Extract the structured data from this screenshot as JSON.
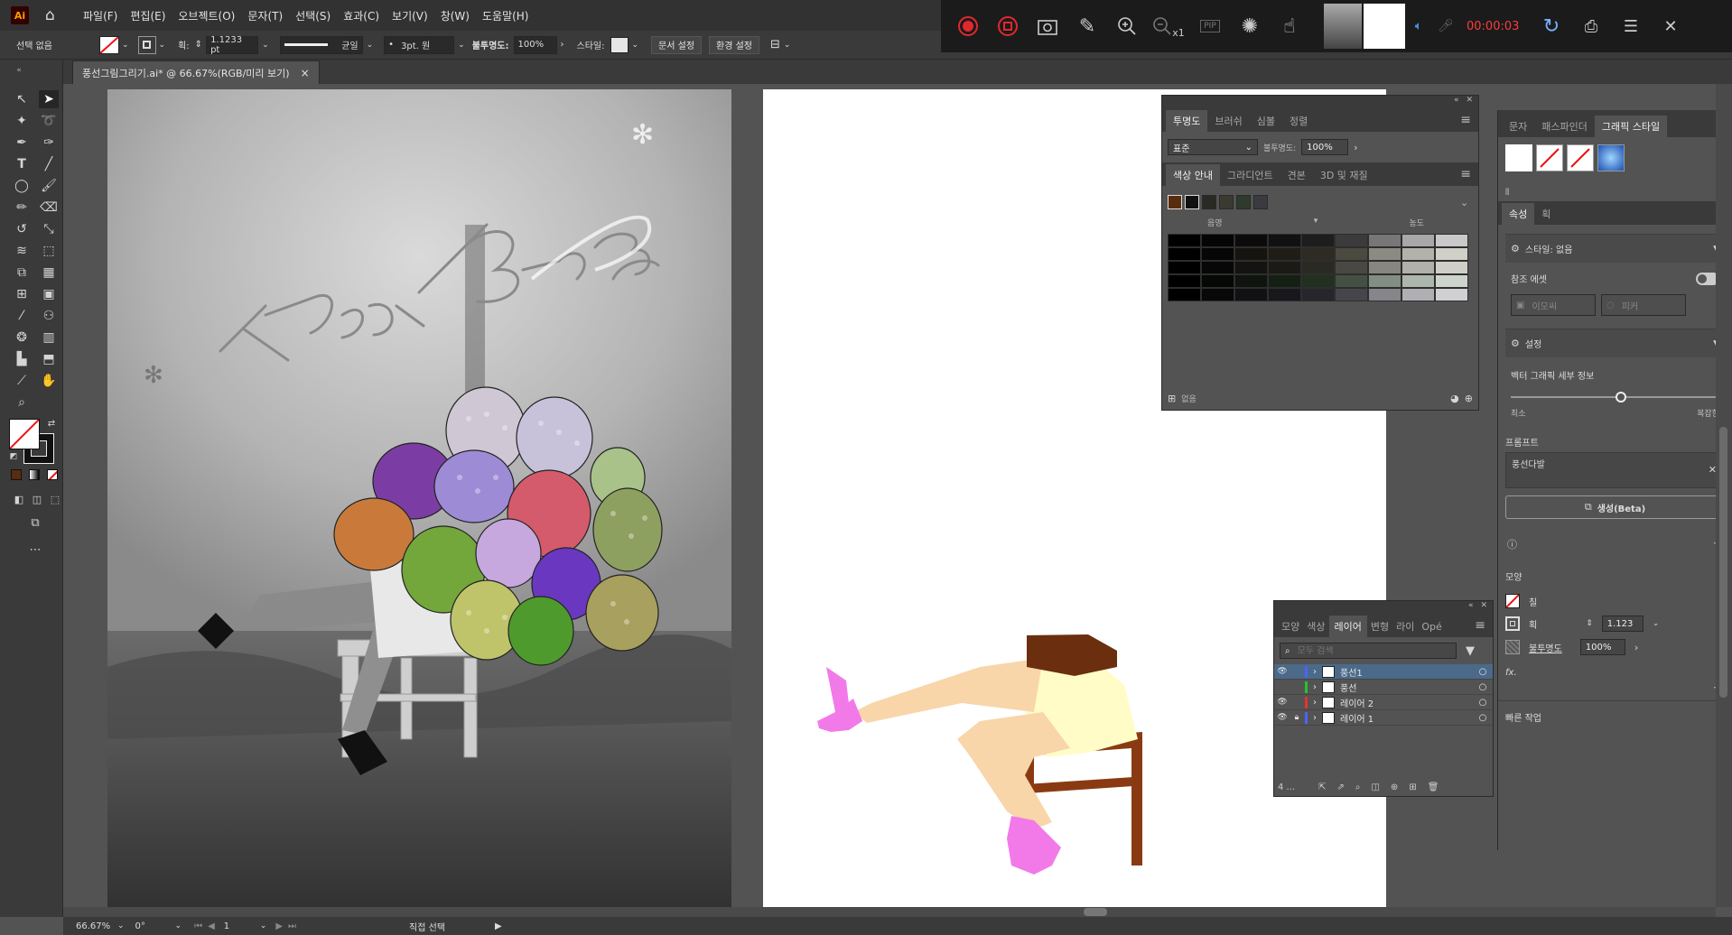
{
  "app": {
    "logo": "Ai",
    "home_icon": "home-icon"
  },
  "menu": [
    "파일(F)",
    "편집(E)",
    "오브젝트(O)",
    "문자(T)",
    "선택(S)",
    "효과(C)",
    "보기(V)",
    "창(W)",
    "도움말(H)"
  ],
  "control": {
    "selection": "선택 없음",
    "stroke_label": "획:",
    "stroke_value": "1.1233 pt",
    "stroke_style": "균일",
    "brush": "3pt. 원",
    "opacity_label": "불투명도:",
    "opacity_value": "100%",
    "style_label": "스타일:",
    "doc_setup": "문서 설정",
    "preferences": "환경 설정"
  },
  "recorder": {
    "zoom_out_suffix": "x1",
    "pip": "PIP",
    "timer": "00:00:03"
  },
  "document_tab": {
    "title": "풍선그림그리기.ai* @ 66.67%(RGB/미리 보기)",
    "close": "×"
  },
  "photo": {
    "text": "Happy B-day"
  },
  "transparency_panel": {
    "tabs": [
      "투명도",
      "브러쉬",
      "심볼",
      "정렬"
    ],
    "blend_mode": "표준",
    "opacity_label": "불투명도:",
    "opacity_value": "100%"
  },
  "color_guide_panel": {
    "tabs": [
      "색상 안내",
      "그라디언트",
      "견본",
      "3D 및 재질"
    ],
    "shade_label": "음영",
    "tint_label": "농도",
    "footer_label": "없음",
    "base_colors": [
      "#5a2c0e",
      "#111111",
      "#2a2a24",
      "#3a3a32",
      "#2e3a2e",
      "#3a3a40"
    ],
    "grid_rows": [
      [
        "#000000",
        "#050505",
        "#0b0b0b",
        "#111111",
        "#1d1d1d",
        "#3b3b3b",
        "#777777",
        "#a8a8a8",
        "#c9c9c9"
      ],
      [
        "#000000",
        "#060606",
        "#16140f",
        "#1f1d16",
        "#2d2b22",
        "#4b4a3f",
        "#8c8b82",
        "#b3b2aa",
        "#d0cfc8"
      ],
      [
        "#000000",
        "#070707",
        "#141311",
        "#1b1a16",
        "#2a2a24",
        "#494842",
        "#87867f",
        "#b1b0a9",
        "#cfcfc8"
      ],
      [
        "#000000",
        "#060806",
        "#0f140f",
        "#152015",
        "#223022",
        "#435043",
        "#828e82",
        "#adb6ad",
        "#cdd3cd"
      ],
      [
        "#000000",
        "#080808",
        "#111113",
        "#18181c",
        "#26262c",
        "#45454b",
        "#85858a",
        "#b0b0b4",
        "#d0d0d2"
      ]
    ]
  },
  "layers_panel": {
    "tabs": [
      "모양",
      "색상",
      "레이어",
      "변형",
      "라이",
      "Opé"
    ],
    "search_placeholder": "모두 검색",
    "layers": [
      {
        "name": "풍선1",
        "color": "#4b63ff",
        "visible": true,
        "locked": false,
        "selected": true
      },
      {
        "name": "풍선",
        "color": "#23c42f",
        "visible": false,
        "locked": false,
        "selected": false
      },
      {
        "name": "레이어 2",
        "color": "#e53333",
        "visible": true,
        "locked": false,
        "selected": false
      },
      {
        "name": "레이어 1",
        "color": "#4b63ff",
        "visible": true,
        "locked": true,
        "selected": false
      }
    ],
    "footer_count": "4 ..."
  },
  "right_panel": {
    "tabs": [
      "문자",
      "패스파인더",
      "그래픽 스타일"
    ],
    "properties_tabs": [
      "속성",
      "획"
    ],
    "style_section": "스타일: 없음",
    "reference_asset": "참조 에셋",
    "subject_btn": "이모씨",
    "pattern_btn": "피커",
    "settings_section": "설정",
    "vector_detail": "벡터 그래픽 세부 정보",
    "min": "최소",
    "complex": "복잡한",
    "prompt_label": "프롬프트",
    "prompt_value": "풍선다발",
    "generate_btn": "생성(Beta)",
    "appearance_label": "모양",
    "fill_label": "칠",
    "stroke_label": "획",
    "stroke_value": "1.123",
    "opacity_label": "불투명도",
    "opacity_value": "100%",
    "fx": "fx.",
    "quick_actions": "빠른 작업"
  },
  "status": {
    "zoom": "66.67%",
    "rotation": "0°",
    "artboard": "1",
    "tool": "직접 선택"
  },
  "colors": {
    "accent": "#1473e6",
    "record": "#e0282e",
    "timer": "#ff3b3b"
  },
  "drawing": {
    "hair": "#6b2e0e",
    "skin": "#f8d6aa",
    "dress": "#fffcc8",
    "chair": "#8a3a12",
    "shoe": "#f27ae8"
  }
}
